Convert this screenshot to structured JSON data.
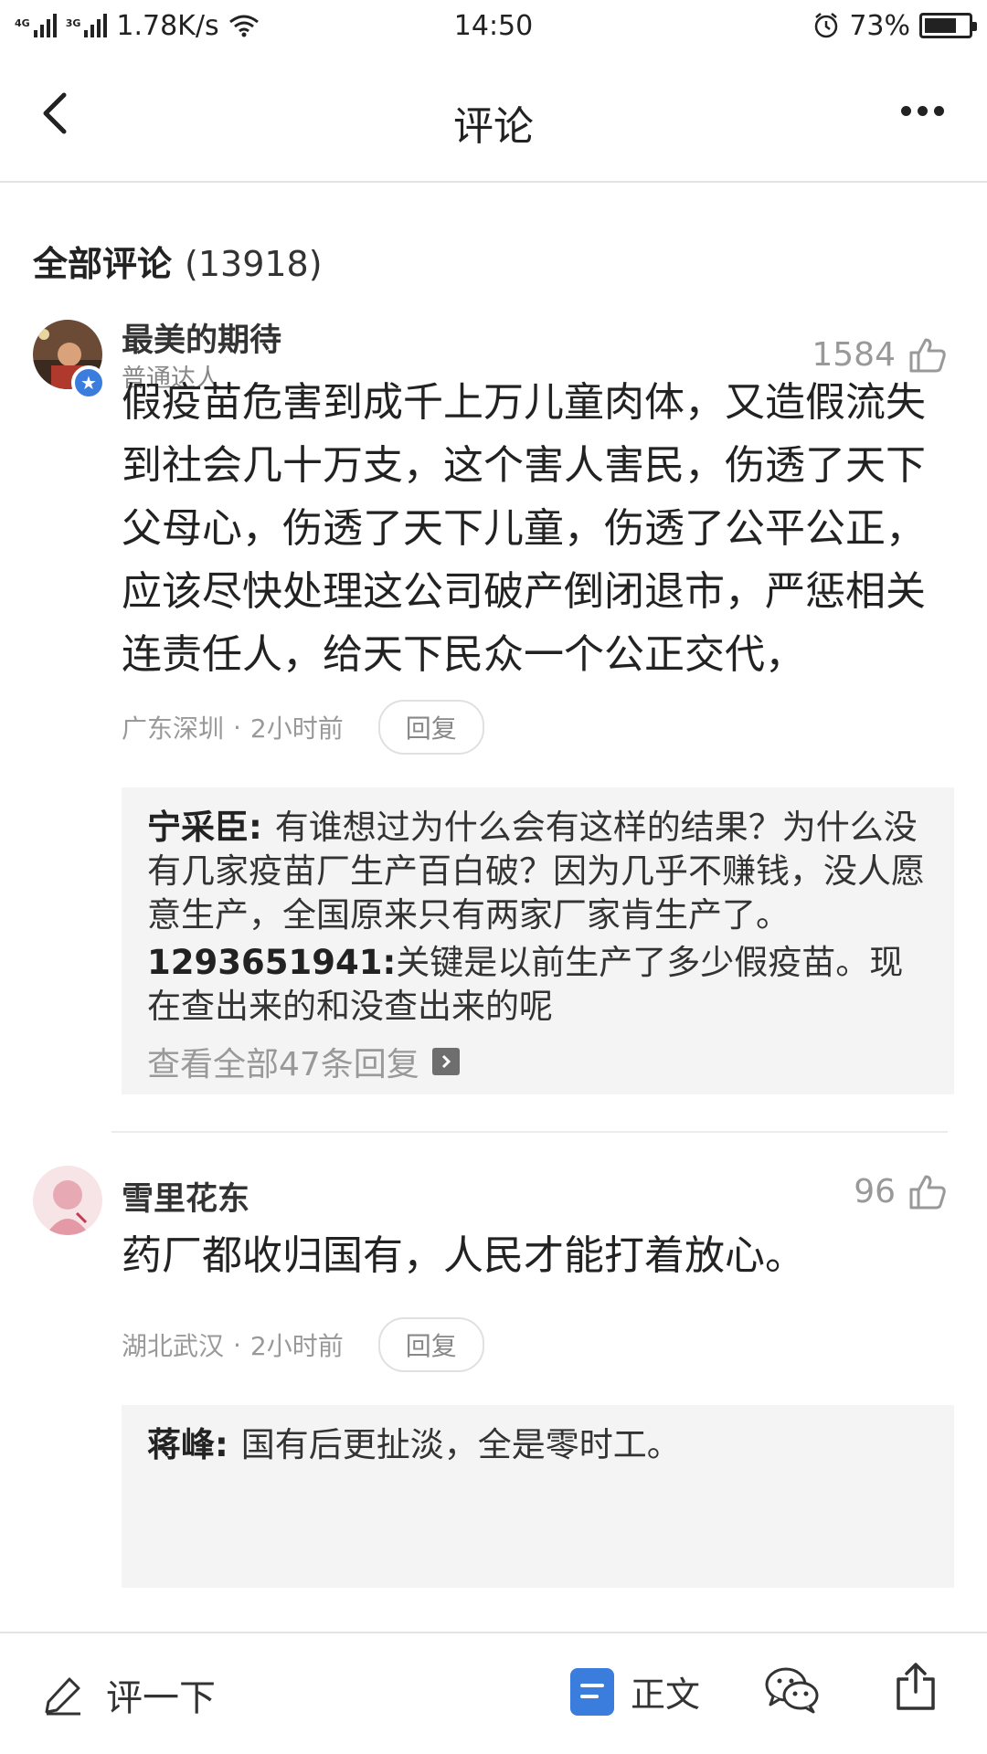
{
  "status_bar": {
    "network_1": "4G",
    "network_2": "3G",
    "speed": "1.78K/s",
    "time": "14:50",
    "battery_percent": "73%",
    "battery_level": 0.73
  },
  "nav": {
    "title": "评论"
  },
  "section": {
    "title": "全部评论",
    "count": "(13918)"
  },
  "comments": [
    {
      "user": "最美的期待",
      "tag": "普通达人",
      "likes": "1584",
      "text": "假疫苗危害到成千上万儿童肉体，又造假流失到社会几十万支，这个害人害民，伤透了天下父母心，伤透了天下儿童，伤透了公平公正，应该尽快处理这公司破产倒闭退市，严惩相关连责任人，给天下民众一个公正交代，",
      "location": "广东深圳",
      "time": "2小时前",
      "reply_label": "回复",
      "replies": [
        {
          "user": "宁采臣:",
          "text": "有谁想过为什么会有这样的结果？为什么没有几家疫苗厂生产百白破？因为几乎不赚钱，没人愿意生产，全国原来只有两家厂家肯生产了。"
        },
        {
          "user": "1293651941:",
          "text": "关键是以前生产了多少假疫苗。现在查出来的和没查出来的呢"
        }
      ],
      "view_all": "查看全部47条回复"
    },
    {
      "user": "雪里花东",
      "likes": "96",
      "text": "药厂都收归国有，人民才能打着放心。",
      "location": "湖北武汉",
      "time": "2小时前",
      "reply_label": "回复",
      "replies": [
        {
          "user": "蒋峰:",
          "text": "国有后更扯淡，全是零时工。"
        }
      ]
    }
  ],
  "bottom_bar": {
    "comment_placeholder": "评一下",
    "body_label": "正文"
  },
  "colors": {
    "accent": "#3b7ddd",
    "reply_bg": "#f4f4f4",
    "muted_text": "#999999"
  },
  "icons": [
    "back-icon",
    "more-icon",
    "like-icon",
    "pencil-icon",
    "document-icon",
    "chat-icon",
    "share-icon",
    "verified-badge-icon"
  ]
}
